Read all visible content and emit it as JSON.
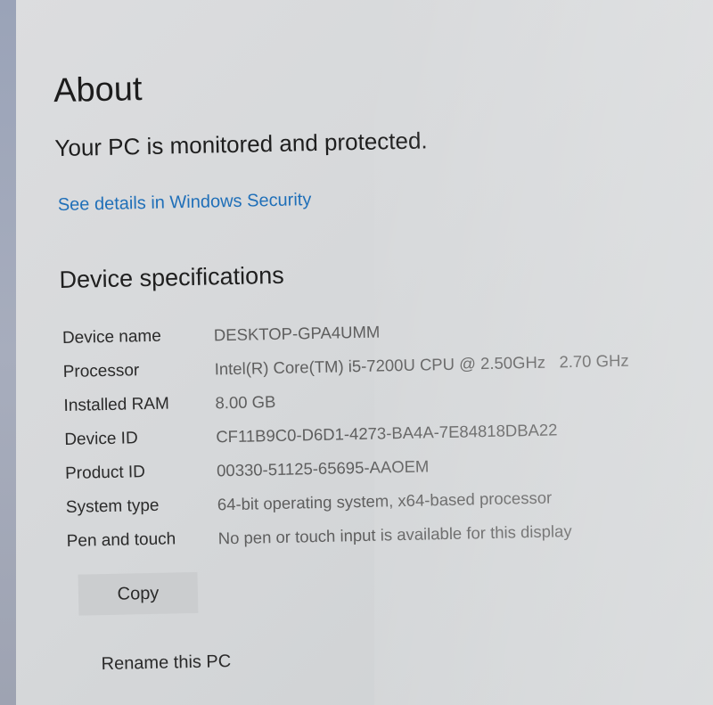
{
  "page": {
    "title": "About",
    "protection_message": "Your PC is monitored and protected.",
    "security_link": "See details in Windows Security"
  },
  "device_specs": {
    "heading": "Device specifications",
    "rows": [
      {
        "label": "Device name",
        "value": "DESKTOP-GPA4UMM"
      },
      {
        "label": "Processor",
        "value": "Intel(R) Core(TM) i5-7200U CPU @ 2.50GHz   2.70 GHz"
      },
      {
        "label": "Installed RAM",
        "value": "8.00 GB"
      },
      {
        "label": "Device ID",
        "value": "CF11B9C0-D6D1-4273-BA4A-7E84818DBA22"
      },
      {
        "label": "Product ID",
        "value": "00330-51125-65695-AAOEM"
      },
      {
        "label": "System type",
        "value": "64-bit operating system, x64-based processor"
      },
      {
        "label": "Pen and touch",
        "value": "No pen or touch input is available for this display"
      }
    ]
  },
  "actions": {
    "copy_label": "Copy",
    "rename_label": "Rename this PC"
  },
  "colors": {
    "link": "#1f6fb8",
    "button_bg": "#cbcdcf",
    "background": "#d8dadc"
  }
}
